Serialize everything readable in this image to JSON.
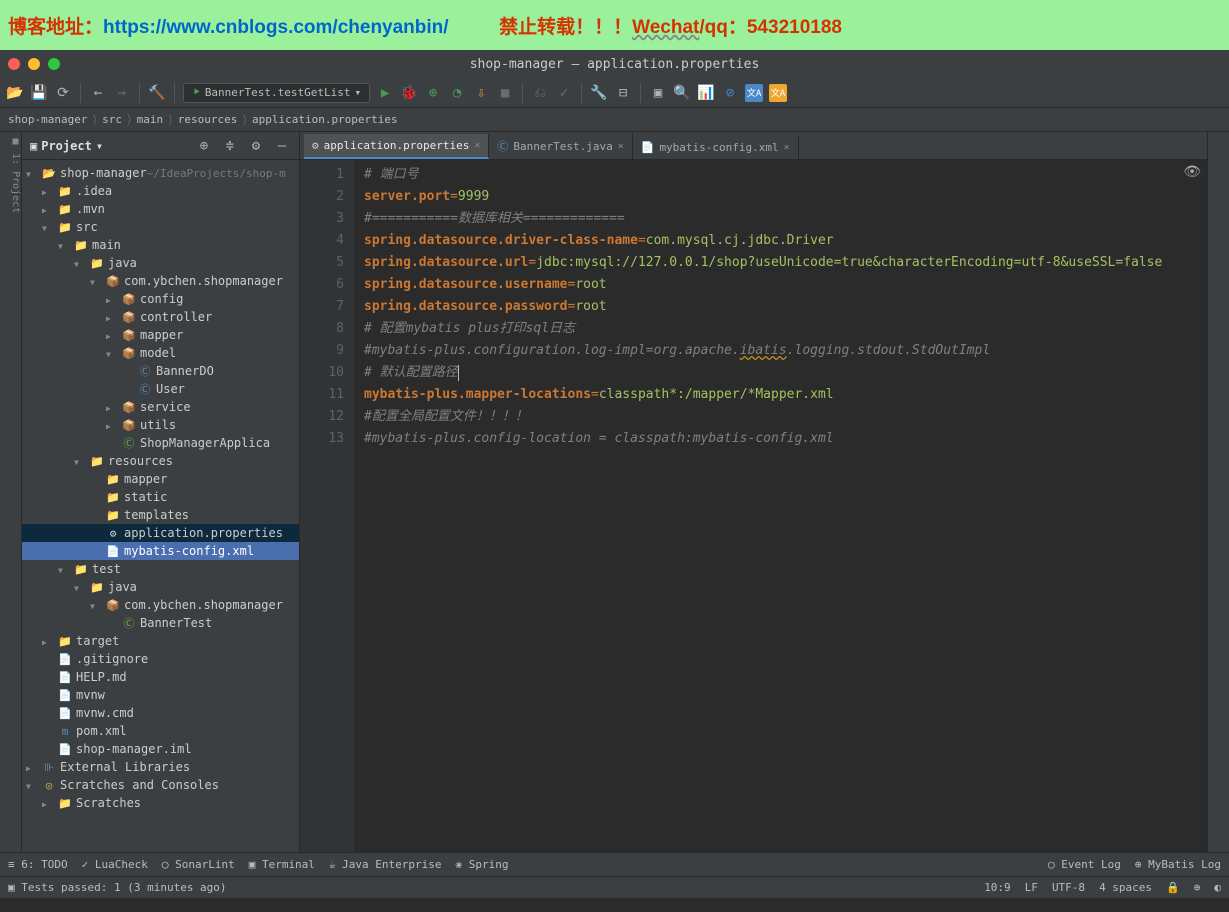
{
  "banner": {
    "blog_label": "博客地址：",
    "url": "https://www.cnblogs.com/chenyanbin/",
    "no_copy": "禁止转载！！！",
    "wechat": "Wechat",
    "contact": "/qq：543210188"
  },
  "window_title": "shop-manager – application.properties",
  "run_config": "BannerTest.testGetList",
  "breadcrumbs": [
    "shop-manager",
    "src",
    "main",
    "resources",
    "application.properties"
  ],
  "project_label": "Project",
  "tree": [
    {
      "d": 0,
      "a": "ex",
      "i": "📂",
      "ic": "f-bfolder",
      "t": "shop-manager",
      "suffix": "~/IdeaProjects/shop-m"
    },
    {
      "d": 1,
      "a": "cl",
      "i": "📁",
      "ic": "f-folder",
      "t": ".idea"
    },
    {
      "d": 1,
      "a": "cl",
      "i": "📁",
      "ic": "f-folder",
      "t": ".mvn"
    },
    {
      "d": 1,
      "a": "ex",
      "i": "📁",
      "ic": "f-bfolder",
      "t": "src"
    },
    {
      "d": 2,
      "a": "ex",
      "i": "📁",
      "ic": "f-bfolder",
      "t": "main"
    },
    {
      "d": 3,
      "a": "ex",
      "i": "📁",
      "ic": "f-bfolder",
      "t": "java"
    },
    {
      "d": 4,
      "a": "ex",
      "i": "📦",
      "ic": "f-pkg",
      "t": "com.ybchen.shopmanager"
    },
    {
      "d": 5,
      "a": "cl",
      "i": "📦",
      "ic": "f-pkg",
      "t": "config"
    },
    {
      "d": 5,
      "a": "cl",
      "i": "📦",
      "ic": "f-pkg",
      "t": "controller"
    },
    {
      "d": 5,
      "a": "cl",
      "i": "📦",
      "ic": "f-pkg",
      "t": "mapper"
    },
    {
      "d": 5,
      "a": "ex",
      "i": "📦",
      "ic": "f-pkg",
      "t": "model"
    },
    {
      "d": 6,
      "a": "",
      "i": "Ⓒ",
      "ic": "f-class",
      "t": "BannerDO"
    },
    {
      "d": 6,
      "a": "",
      "i": "Ⓒ",
      "ic": "f-class",
      "t": "User"
    },
    {
      "d": 5,
      "a": "cl",
      "i": "📦",
      "ic": "f-pkg",
      "t": "service"
    },
    {
      "d": 5,
      "a": "cl",
      "i": "📦",
      "ic": "f-pkg",
      "t": "utils"
    },
    {
      "d": 5,
      "a": "",
      "i": "Ⓒ",
      "ic": "f-green",
      "t": "ShopManagerApplica"
    },
    {
      "d": 3,
      "a": "ex",
      "i": "📁",
      "ic": "f-folder",
      "t": "resources"
    },
    {
      "d": 4,
      "a": "",
      "i": "📁",
      "ic": "f-folder",
      "t": "mapper"
    },
    {
      "d": 4,
      "a": "",
      "i": "📁",
      "ic": "f-folder",
      "t": "static"
    },
    {
      "d": 4,
      "a": "",
      "i": "📁",
      "ic": "f-folder",
      "t": "templates"
    },
    {
      "d": 4,
      "a": "",
      "i": "⚙",
      "ic": "f-gear",
      "t": "application.properties",
      "sel": "sel2"
    },
    {
      "d": 4,
      "a": "",
      "i": "📄",
      "ic": "orange",
      "t": "mybatis-config.xml",
      "sel": "sel"
    },
    {
      "d": 2,
      "a": "ex",
      "i": "📁",
      "ic": "f-bfolder",
      "t": "test"
    },
    {
      "d": 3,
      "a": "ex",
      "i": "📁",
      "ic": "f-green",
      "t": "java"
    },
    {
      "d": 4,
      "a": "ex",
      "i": "📦",
      "ic": "f-pkg",
      "t": "com.ybchen.shopmanager"
    },
    {
      "d": 5,
      "a": "",
      "i": "Ⓒ",
      "ic": "f-green",
      "t": "BannerTest"
    },
    {
      "d": 1,
      "a": "cl",
      "i": "📁",
      "ic": "orange",
      "t": "target"
    },
    {
      "d": 1,
      "a": "",
      "i": "📄",
      "ic": "f-file",
      "t": ".gitignore"
    },
    {
      "d": 1,
      "a": "",
      "i": "📄",
      "ic": "f-file",
      "t": "HELP.md"
    },
    {
      "d": 1,
      "a": "",
      "i": "📄",
      "ic": "f-file",
      "t": "mvnw"
    },
    {
      "d": 1,
      "a": "",
      "i": "📄",
      "ic": "f-file",
      "t": "mvnw.cmd"
    },
    {
      "d": 1,
      "a": "",
      "i": "m",
      "ic": "f-class",
      "t": "pom.xml"
    },
    {
      "d": 1,
      "a": "",
      "i": "📄",
      "ic": "f-file",
      "t": "shop-manager.iml"
    },
    {
      "d": 0,
      "a": "cl",
      "i": "⊪",
      "ic": "f-class",
      "t": "External Libraries"
    },
    {
      "d": 0,
      "a": "ex",
      "i": "◎",
      "ic": "f-folder",
      "t": "Scratches and Consoles"
    },
    {
      "d": 1,
      "a": "cl",
      "i": "📁",
      "ic": "f-folder",
      "t": "Scratches"
    }
  ],
  "tabs": [
    {
      "icon": "⚙",
      "color": "#ccc",
      "name": "application.properties",
      "active": true
    },
    {
      "icon": "Ⓒ",
      "color": "#5b8fbb",
      "name": "BannerTest.java",
      "active": false
    },
    {
      "icon": "📄",
      "color": "#f0a732",
      "name": "mybatis-config.xml",
      "active": false
    }
  ],
  "code": {
    "l1": "# 端口号",
    "l2k": "server.port",
    "l2v": "9999",
    "l3": "#===========数据库相关=============",
    "l4k": "spring.datasource.driver-class-name",
    "l4v1": "com",
    "l4v2": "mysql",
    "l4v3": "cj",
    "l4v4": "jdbc",
    "l4v5": "Driver",
    "l5k": "spring.datasource.url",
    "l5v": "jdbc:mysql://127.0.0.1/shop?useUnicode=true&characterEncoding=utf-8&useSSL=false",
    "l6k": "spring.datasource.username",
    "l6v": "root",
    "l7k": "spring.datasource.password",
    "l7v": "root",
    "l8": "# 配置mybatis plus打印sql日志",
    "l9a": "#mybatis-plus.configuration.log-impl=",
    "l9b": "org",
    "l9c": "apache",
    "l9d": "ibatis",
    "l9e": "logging",
    "l9f": "stdout",
    "l9g": "StdOutImpl",
    "l10": "# 默认配置路径",
    "l11k": "mybatis-plus.mapper-locations",
    "l11v": "classpath*:/mapper/*Mapper.xml",
    "l12": "#配置全局配置文件！！！！",
    "l13": "#mybatis-plus.config-location = classpath:mybatis-config.xml"
  },
  "bottom_tools": {
    "left": [
      "≡ 6: TODO",
      "✓ LuaCheck",
      "◯ SonarLint",
      "▣ Terminal",
      "☕ Java Enterprise",
      "❀ Spring"
    ],
    "right": [
      "◯ Event Log",
      "⊕ MyBatis Log"
    ]
  },
  "status": {
    "left": "Tests passed: 1 (3 minutes ago)",
    "right": [
      "10:9",
      "LF",
      "UTF-8",
      "4 spaces",
      "🔒",
      "⊕",
      "◐"
    ]
  }
}
